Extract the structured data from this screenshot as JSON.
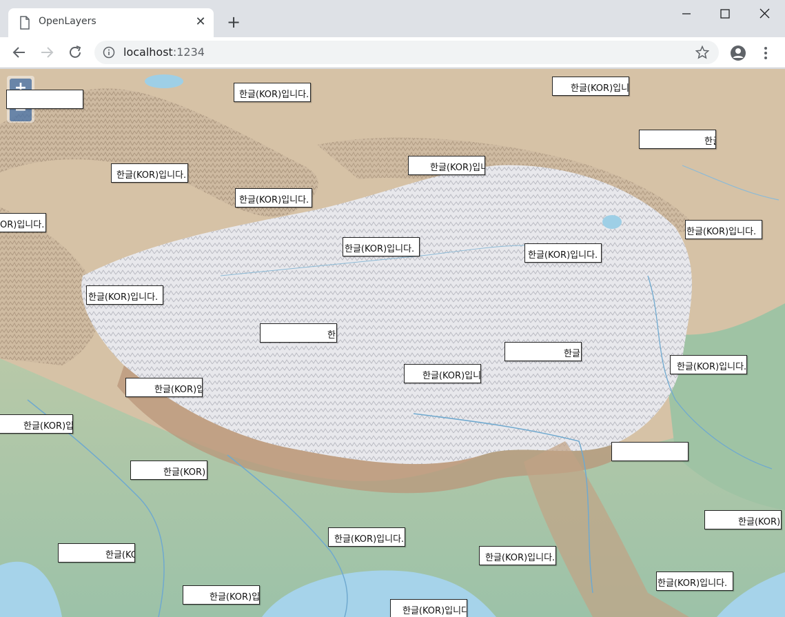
{
  "browser": {
    "tab_title": "OpenLayers",
    "tab_close": "✕",
    "new_tab": "+",
    "url_host": "localhost",
    "url_port": ":1234"
  },
  "map": {
    "zoom_in": "+",
    "zoom_out": "−",
    "overlays": [
      {
        "text": ""
      },
      {
        "text": "한글(KOR)입니다."
      },
      {
        "text": "한글(KOR)입니"
      },
      {
        "text": "한글"
      },
      {
        "text": "한글(KOR)입니다."
      },
      {
        "text": "한글(KOR)입니"
      },
      {
        "text": "한글(KOR)입니다."
      },
      {
        "text": "OR)입니다."
      },
      {
        "text": "한글(KOR)입니다."
      },
      {
        "text": "한글(KOR)입니다."
      },
      {
        "text": "한글(KOR)입니다."
      },
      {
        "text": "한글(KOR)입니다."
      },
      {
        "text": "한"
      },
      {
        "text": "한글"
      },
      {
        "text": "한글(KOR)입니다."
      },
      {
        "text": "한글(KOR)입니"
      },
      {
        "text": "한글(KOR)입"
      },
      {
        "text": "한글(KOR)입"
      },
      {
        "text": ""
      },
      {
        "text": "한글(KOR)"
      },
      {
        "text": "한글(KOR)"
      },
      {
        "text": "한글(KOR)입니다."
      },
      {
        "text": "한글(KC"
      },
      {
        "text": "한글(KOR)입니다."
      },
      {
        "text": "한글(KOR)입니다."
      },
      {
        "text": "한글(KOR)입"
      },
      {
        "text": "한글(KOR)입니다"
      }
    ]
  },
  "colors": {
    "desert": "#d8c4a6",
    "plateau": "#e9e9ec",
    "lowland": "#a8c7a0",
    "water": "#a8d4ea",
    "zoom": "#4e6f9d"
  }
}
